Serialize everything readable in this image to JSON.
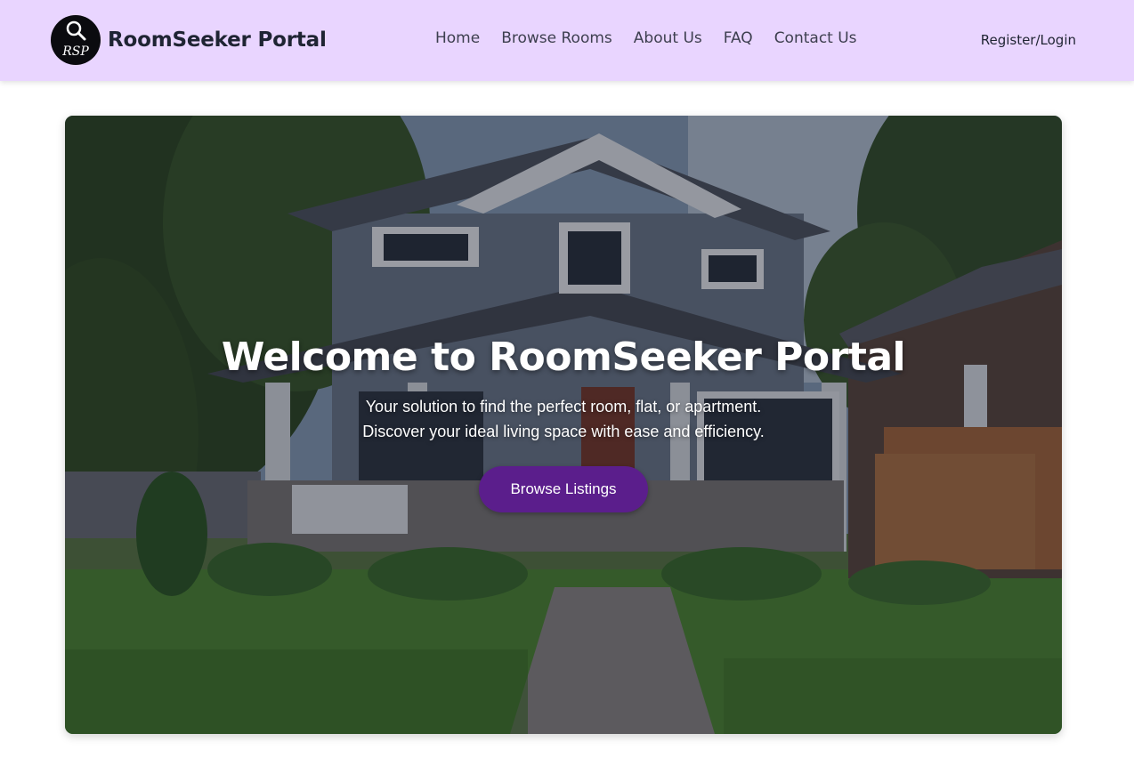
{
  "header": {
    "brand_name": "RoomSeeker Portal",
    "logo_text": "RSP",
    "nav": [
      {
        "label": "Home"
      },
      {
        "label": "Browse Rooms"
      },
      {
        "label": "About Us"
      },
      {
        "label": "FAQ"
      },
      {
        "label": "Contact Us"
      }
    ],
    "auth_label": "Register/Login"
  },
  "hero": {
    "title": "Welcome to RoomSeeker Portal",
    "subtitle_line1": "Your solution to find the perfect room, flat, or apartment.",
    "subtitle_line2": "Discover your ideal living space with ease and efficiency.",
    "cta_label": "Browse Listings",
    "background_description_icon": "house-photo"
  },
  "colors": {
    "header_bg": "#e9d5ff",
    "cta_bg": "#5b1e8c",
    "text_dark": "#1f2433"
  }
}
